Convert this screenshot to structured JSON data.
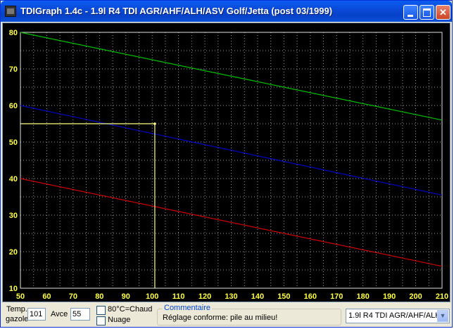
{
  "window": {
    "title": "TDIGraph 1.4c - 1.9l R4 TDI AGR/AHF/ALH/ASV Golf/Jetta (post 03/1999)",
    "title_bar_color": "#0a4fd9"
  },
  "bottom": {
    "temp_label": "Temp.",
    "temp_label2": "gazole",
    "temp_value": "101",
    "avce_label": "Avce",
    "avce_value": "55",
    "checkbox_hot": "80°C=Chaud",
    "checkbox_cloud": "Nuage",
    "comment_title": "Commentaire",
    "comment_text": "Réglage conforme: pile au milieu!",
    "engine_select": "1.9l R4 TDI AGR/AHF/ALH"
  },
  "chart_data": {
    "type": "line",
    "x_ticks": [
      50,
      60,
      70,
      80,
      90,
      100,
      110,
      120,
      130,
      140,
      150,
      160,
      170,
      180,
      190,
      200,
      210
    ],
    "y_ticks": [
      10,
      20,
      30,
      40,
      50,
      60,
      70,
      80
    ],
    "xlim": [
      50,
      210
    ],
    "ylim": [
      10,
      80
    ],
    "grid": true,
    "background": "#000000",
    "series": [
      {
        "color": "#00c000",
        "x": [
          50,
          210
        ],
        "y": [
          80,
          56
        ]
      },
      {
        "color": "#0000c8",
        "x": [
          50,
          210
        ],
        "y": [
          60,
          35.5
        ]
      },
      {
        "color": "#d00000",
        "x": [
          50,
          210
        ],
        "y": [
          40,
          16
        ]
      }
    ],
    "marker": {
      "color": "#ffff80",
      "x": 101,
      "y": 55
    }
  }
}
